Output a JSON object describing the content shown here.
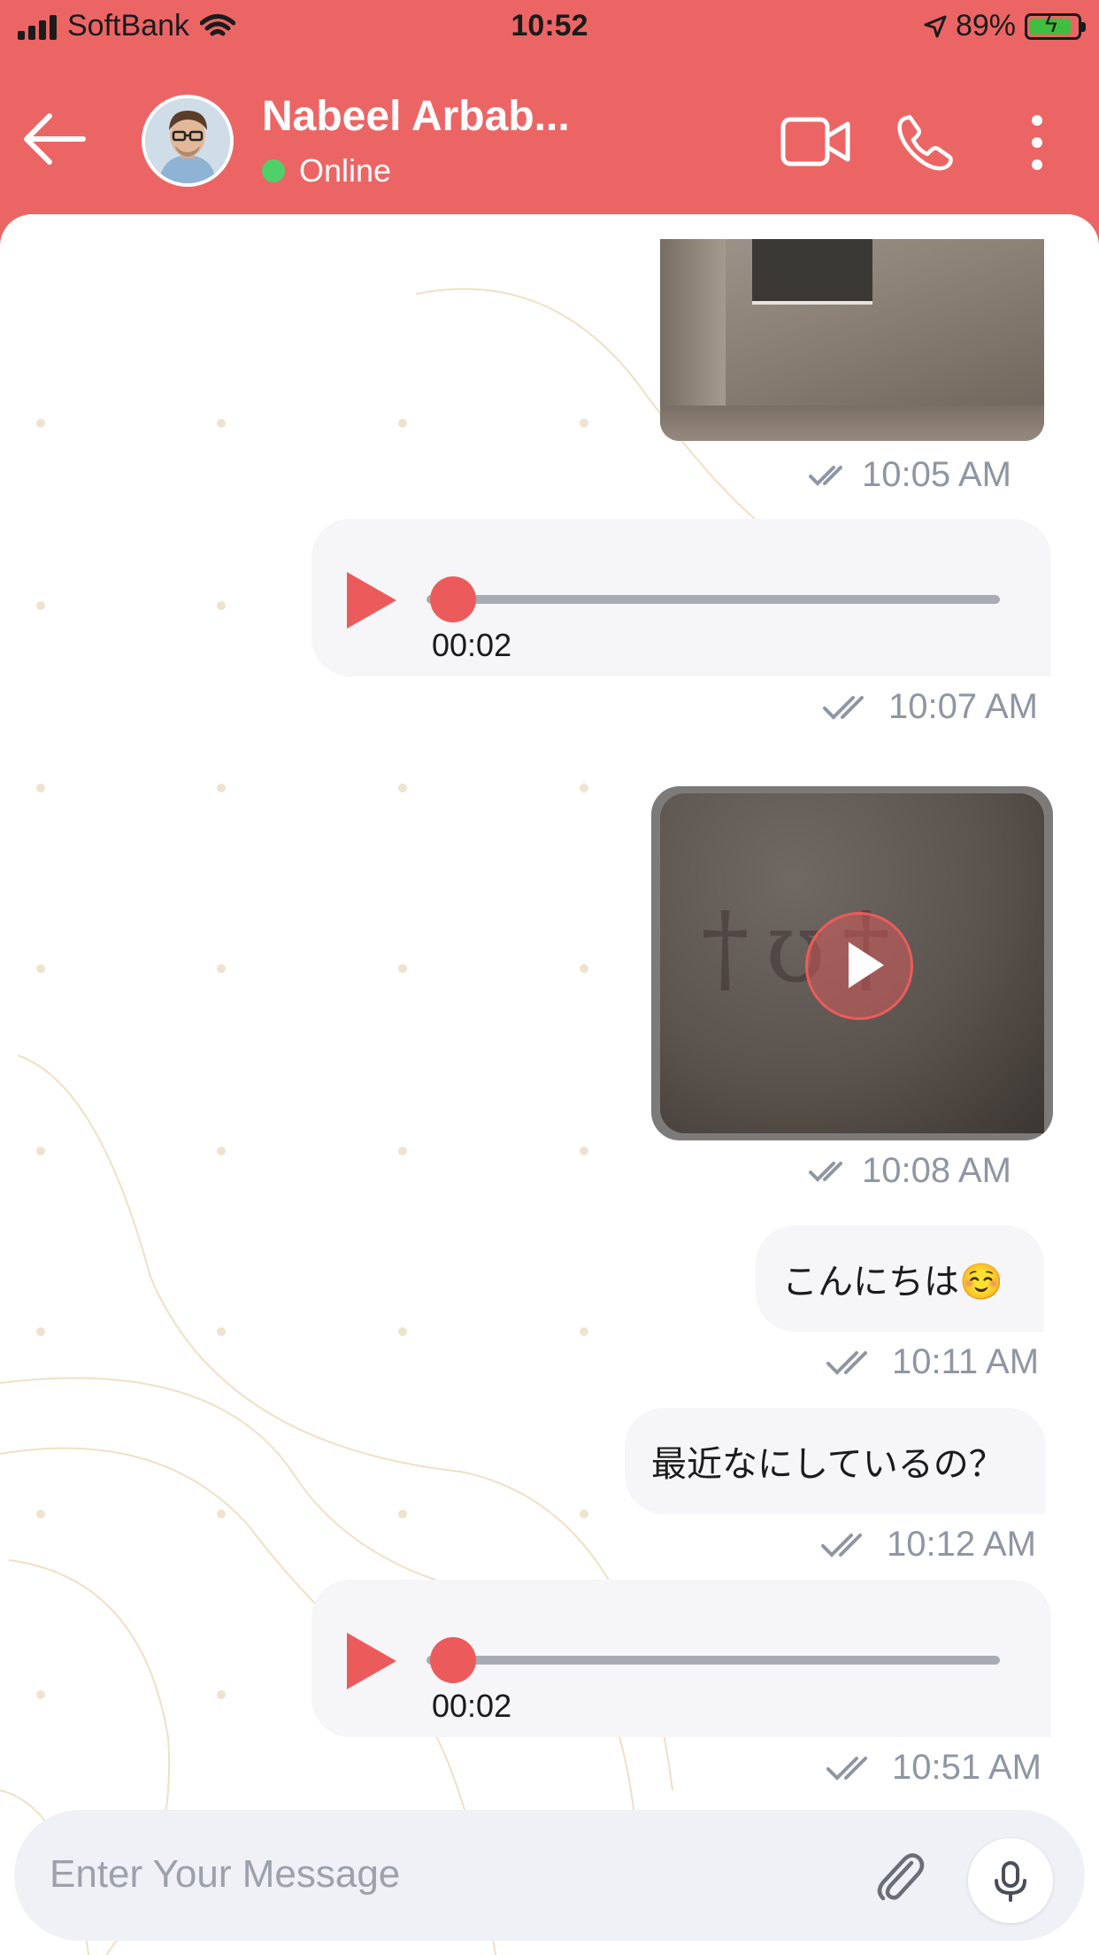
{
  "status_bar": {
    "carrier": "SoftBank",
    "time": "10:52",
    "battery": "89%",
    "battery_level": 0.89
  },
  "header": {
    "back_icon": "arrow-left-icon",
    "contact_name": "Nabeel Arbab...",
    "presence": "Online",
    "presence_color": "#4fd16a",
    "video_icon": "video-camera-icon",
    "call_icon": "phone-icon",
    "more_icon": "more-vertical-icon"
  },
  "theme": {
    "accent": "#ec6565",
    "bubble": "#f6f6f8",
    "timestamp": "#8f96a3"
  },
  "messages": [
    {
      "type": "image",
      "time": "10:05 AM"
    },
    {
      "type": "audio",
      "duration": "00:02",
      "time": "10:07 AM"
    },
    {
      "type": "video",
      "time": "10:08 AM"
    },
    {
      "type": "text",
      "text": "こんにちは☺️",
      "time": "10:11 AM"
    },
    {
      "type": "text",
      "text": "最近なにしているの？",
      "time": "10:12 AM"
    },
    {
      "type": "audio",
      "duration": "00:02",
      "time": "10:51 AM"
    }
  ],
  "input": {
    "placeholder": "Enter Your Message",
    "attach_icon": "paperclip-icon",
    "mic_icon": "microphone-icon"
  }
}
